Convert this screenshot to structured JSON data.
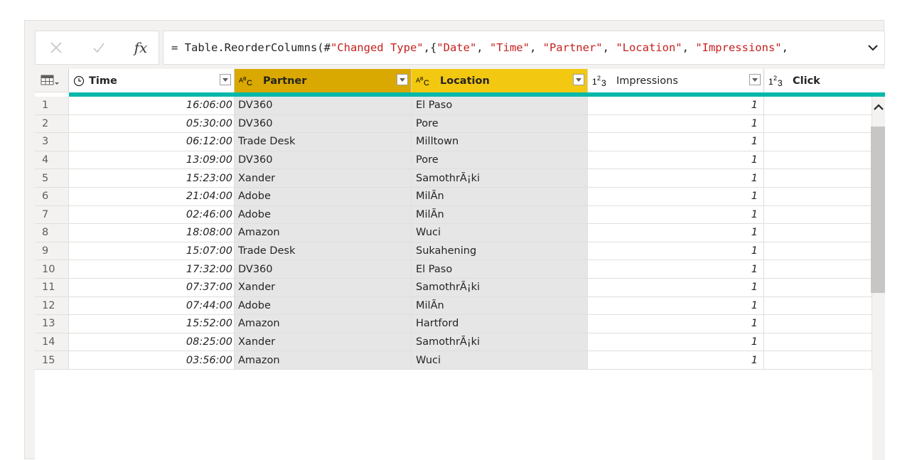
{
  "formula_bar": {
    "prefix": "= Table.ReorderColumns(#",
    "s1": "\"Changed Type\"",
    "mid1": ",{",
    "s2": "\"Date\"",
    "c2": ", ",
    "s3": "\"Time\"",
    "c3": ", ",
    "s4": "\"Partner\"",
    "c4": ", ",
    "s5": "\"Location\"",
    "c5": ", ",
    "s6": "\"Impressions\"",
    "c6": ", ",
    "cancel_icon": "x-icon",
    "commit_icon": "check-icon",
    "fx_label": "fx"
  },
  "columns": {
    "time": {
      "label": "Time",
      "type_icon": "clock-icon"
    },
    "partner": {
      "label": "Partner",
      "type_icon": "text-type-icon",
      "type_glyph": "ABC"
    },
    "location": {
      "label": "Location",
      "type_icon": "text-type-icon",
      "type_glyph": "ABC"
    },
    "impressions": {
      "label": "Impressions",
      "type_icon": "number-type-icon",
      "type_glyph": "123"
    },
    "click": {
      "label": "Click",
      "type_icon": "number-type-icon",
      "type_glyph": "123"
    }
  },
  "colors": {
    "partner_header": "#d9a901",
    "location_header": "#f2c811",
    "quality_bar": "#01b8aa",
    "formula_string": "#c5221f"
  },
  "rows": [
    {
      "n": "1",
      "time": "16:06:00",
      "partner": "DV360",
      "location": "El Paso",
      "impressions": "1"
    },
    {
      "n": "2",
      "time": "05:30:00",
      "partner": "DV360",
      "location": "Pore",
      "impressions": "1"
    },
    {
      "n": "3",
      "time": "06:12:00",
      "partner": "Trade Desk",
      "location": "Milltown",
      "impressions": "1"
    },
    {
      "n": "4",
      "time": "13:09:00",
      "partner": "DV360",
      "location": "Pore",
      "impressions": "1"
    },
    {
      "n": "5",
      "time": "15:23:00",
      "partner": "Xander",
      "location": "SamothrÃ¡ki",
      "impressions": "1"
    },
    {
      "n": "6",
      "time": "21:04:00",
      "partner": "Adobe",
      "location": "MilÃn",
      "impressions": "1"
    },
    {
      "n": "7",
      "time": "02:46:00",
      "partner": "Adobe",
      "location": "MilÃn",
      "impressions": "1"
    },
    {
      "n": "8",
      "time": "18:08:00",
      "partner": "Amazon",
      "location": "Wuci",
      "impressions": "1"
    },
    {
      "n": "9",
      "time": "15:07:00",
      "partner": "Trade Desk",
      "location": "Sukahening",
      "impressions": "1"
    },
    {
      "n": "10",
      "time": "17:32:00",
      "partner": "DV360",
      "location": "El Paso",
      "impressions": "1"
    },
    {
      "n": "11",
      "time": "07:37:00",
      "partner": "Xander",
      "location": "SamothrÃ¡ki",
      "impressions": "1"
    },
    {
      "n": "12",
      "time": "07:44:00",
      "partner": "Adobe",
      "location": "MilÃn",
      "impressions": "1"
    },
    {
      "n": "13",
      "time": "15:52:00",
      "partner": "Amazon",
      "location": "Hartford",
      "impressions": "1"
    },
    {
      "n": "14",
      "time": "08:25:00",
      "partner": "Xander",
      "location": "SamothrÃ¡ki",
      "impressions": "1"
    },
    {
      "n": "15",
      "time": "03:56:00",
      "partner": "Amazon",
      "location": "Wuci",
      "impressions": "1"
    }
  ]
}
